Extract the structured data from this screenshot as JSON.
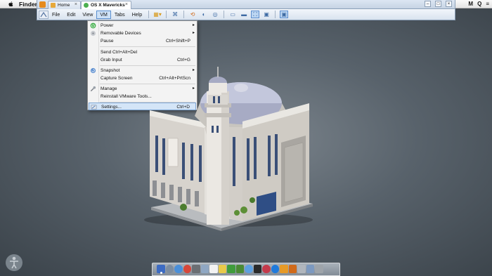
{
  "mac_menubar": {
    "app_name": "Finder",
    "right_items": [
      "M",
      "Q",
      "≡"
    ]
  },
  "tabs": [
    {
      "label": "Home",
      "active": false
    },
    {
      "label": "OS X Mavericks",
      "active": true
    }
  ],
  "toolbar": {
    "menus": [
      "File",
      "Edit",
      "View",
      "VM",
      "Tabs",
      "Help"
    ],
    "active_menu": "VM"
  },
  "vm_menu": {
    "items": [
      {
        "label": "Power",
        "shortcut": "",
        "submenu": true,
        "icon": "power-icon"
      },
      {
        "label": "Removable Devices",
        "shortcut": "",
        "submenu": true,
        "icon": "removable-devices-icon"
      },
      {
        "label": "Pause",
        "shortcut": "Ctrl+Shift+P",
        "submenu": false,
        "icon": ""
      },
      {
        "label": "Send Ctrl+Alt+Del",
        "shortcut": "",
        "submenu": false,
        "icon": ""
      },
      {
        "label": "Grab Input",
        "shortcut": "Ctrl+G",
        "submenu": false,
        "icon": ""
      },
      {
        "label": "Snapshot",
        "shortcut": "",
        "submenu": true,
        "icon": "snapshot-icon"
      },
      {
        "label": "Capture Screen",
        "shortcut": "Ctrl+Alt+PrtScn",
        "submenu": false,
        "icon": ""
      },
      {
        "label": "Manage",
        "shortcut": "",
        "submenu": true,
        "icon": "wrench-icon"
      },
      {
        "label": "Reinstall VMware Tools...",
        "shortcut": "",
        "submenu": false,
        "icon": ""
      },
      {
        "label": "Settings...",
        "shortcut": "Ctrl+D",
        "submenu": false,
        "icon": "settings-icon",
        "highlighted": true
      }
    ]
  },
  "colors": {
    "desktop_center": "#7c858d",
    "desktop_edge": "#3a4249",
    "menu_highlight": "#d4e5f7",
    "accent": "#5a8fcf"
  }
}
